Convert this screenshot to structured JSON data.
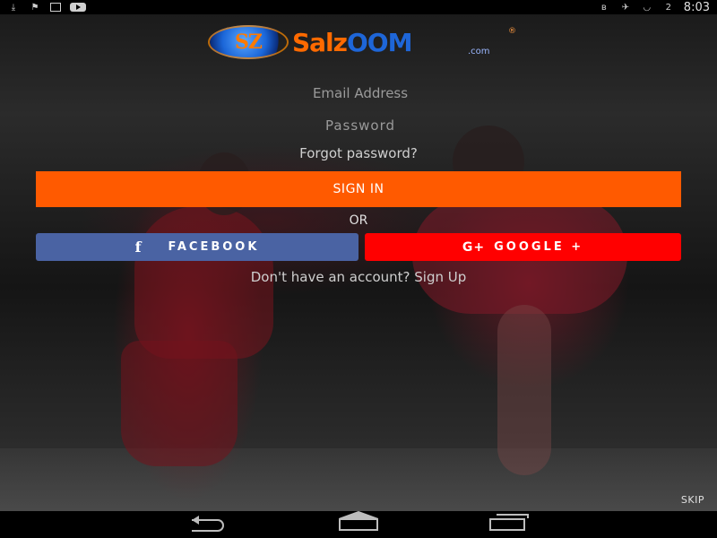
{
  "status_bar": {
    "time": "8:03",
    "icons": [
      "download-icon",
      "flag-icon",
      "barcode-icon",
      "youtube-icon",
      "bluetooth-icon",
      "airplane-off-icon",
      "wifi-icon",
      "battery-icon"
    ],
    "battery_label": "2"
  },
  "logo": {
    "orb_text": "SZ",
    "word_part1": "Salz",
    "word_part2": "OOM",
    "domain": ".com",
    "registered": "®"
  },
  "form": {
    "email_placeholder": "Email Address",
    "password_placeholder": "Password",
    "forgot_label": "Forgot password?",
    "signin_label": "SIGN IN",
    "or_label": "OR",
    "facebook_icon": "f",
    "facebook_label": "FACEBOOK",
    "google_icon": "G+",
    "google_label": "GOOGLE +",
    "signup_label": "Don't have an account? Sign Up"
  },
  "skip_label": "SKIP",
  "colors": {
    "signin_bg": "#ff5a00",
    "facebook_bg": "#4a63a3",
    "google_bg": "#ff0000"
  },
  "navigation": [
    "back-icon",
    "home-icon",
    "recent-apps-icon"
  ]
}
